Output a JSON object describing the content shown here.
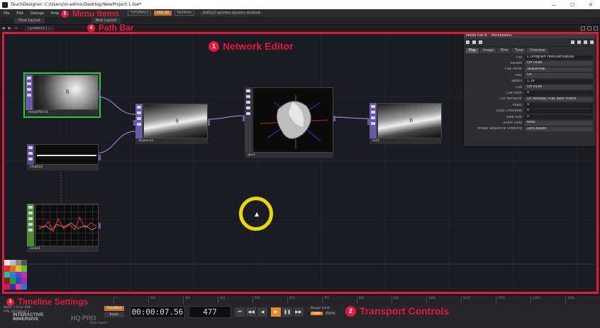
{
  "window": {
    "title": "TouchDesigner: C:/Users/xr-admin/Desktop/NewProject.1.toe*"
  },
  "menu": {
    "items": [
      "File",
      "Edit",
      "Dialogs",
      "Help"
    ],
    "pills": [
      "TUTORIALS",
      "FPS: 60",
      "Realtime"
    ],
    "warning": "4095/17 operator dynamic disabled"
  },
  "pane": {
    "layout_label": "Pane Layout",
    "new_layout_label": "New Layout"
  },
  "path": {
    "value": "/ project1 / ..."
  },
  "annotations": {
    "network_editor": {
      "num": "1",
      "label": "Network Editor"
    },
    "transport": {
      "num": "2",
      "label": "Transport Controls"
    },
    "timeline": {
      "num": "3",
      "label": "Timeline Settings"
    },
    "path_bar": {
      "num": "4",
      "label": "Path Bar"
    },
    "menu_items": {
      "num": "5",
      "label": "Menu Items"
    }
  },
  "nodes": {
    "moviefilein": {
      "name": "moviefilein1"
    },
    "displace": {
      "name": "displace1"
    },
    "chopto": {
      "name": "chopto1"
    },
    "noise": {
      "name": "noise1"
    },
    "geo": {
      "name": "geo1"
    },
    "out": {
      "name": "out1"
    }
  },
  "params": {
    "header_left": "Movie File In",
    "header_right": "moviefilein1",
    "tabs": [
      "Play",
      "Image",
      "Trim",
      "Tune",
      "Common"
    ],
    "rows": [
      {
        "label": "File",
        "value": "C:/Program Files/Derivative/"
      },
      {
        "label": "Reload",
        "value": "Off    Pulse"
      },
      {
        "label": "Play Mode",
        "value": "Sequential"
      },
      {
        "label": "Play",
        "value": "On"
      },
      {
        "label": "Speed",
        "value": "1.19"
      },
      {
        "label": "Cue",
        "value": "Off    Pulse"
      },
      {
        "label": "Cue Point",
        "value": "0"
      },
      {
        "label": "Cue Behavior",
        "value": "On Release, Play Next Frame"
      },
      {
        "label": "Index",
        "value": "0"
      },
      {
        "label": "Loop Crossfade",
        "value": "0"
      },
      {
        "label": "Step Size",
        "value": "1"
      },
      {
        "label": "Audio Loop",
        "value": "Note"
      },
      {
        "label": "Image Sequence Ordering",
        "value": "Zero-Based"
      }
    ]
  },
  "timeline_ticks": [
    "1",
    "201",
    "301",
    "401",
    "501",
    "601",
    "701",
    "801",
    "901",
    "1001",
    "1101",
    "1201",
    "1301",
    "1401"
  ],
  "timeline_settings": {
    "line1": "Start: 1   End: 600",
    "line2": "FPS: 60   RStart 1"
  },
  "transport": {
    "timecode": "00:00:07.56",
    "frame": "477",
    "timeslice_label": "TimeSlice",
    "beats_label": "Beats",
    "range_limit_label": "Range Limit",
    "range_loop": "Loop",
    "range_once": "Once",
    "buttons": [
      "⏮",
      "◀◀",
      "◀",
      "▶",
      "❚❚",
      "▶▶",
      "⏭"
    ]
  },
  "logo": {
    "line1": "INTERACTIVE",
    "line2": "IMMERSIVE",
    "badge": "HQ PRO"
  },
  "view_public": "View Public"
}
